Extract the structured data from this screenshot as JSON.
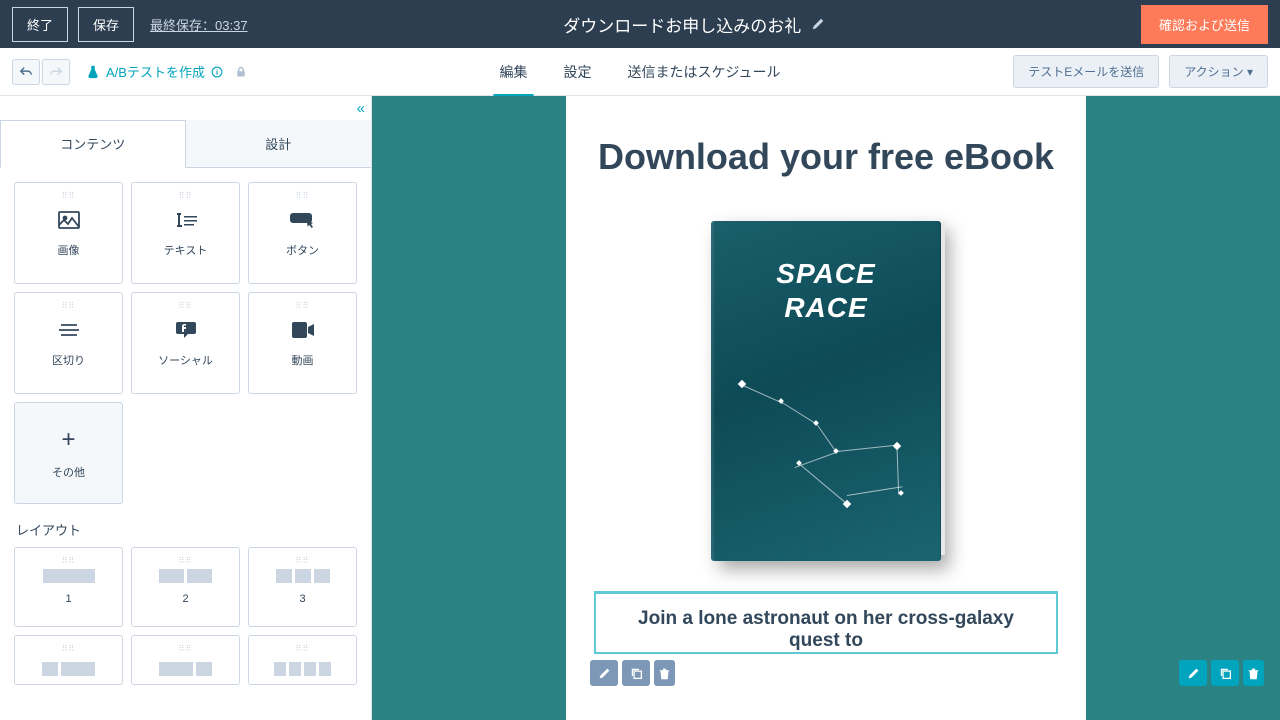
{
  "topbar": {
    "exit": "終了",
    "save": "保存",
    "lastSaved": "最終保存：03:37",
    "title": "ダウンロードお申し込みのお礼",
    "primary": "確認および送信"
  },
  "subbar": {
    "abTest": "A/Bテストを作成",
    "tabs": {
      "edit": "編集",
      "settings": "設定",
      "send": "送信またはスケジュール"
    },
    "testEmail": "テストEメールを送信",
    "actions": "アクション ▾"
  },
  "sidebar": {
    "collapse": "«",
    "tabs": {
      "content": "コンテンツ",
      "design": "設計"
    },
    "blocks": {
      "image": "画像",
      "text": "テキスト",
      "button": "ボタン",
      "divider": "区切り",
      "social": "ソーシャル",
      "video": "動画",
      "more": "その他"
    },
    "layoutHeader": "レイアウト",
    "layouts": {
      "one": "1",
      "two": "2",
      "three": "3"
    }
  },
  "email": {
    "headline": "Download your free eBook",
    "bookTitleLine1": "SPACE",
    "bookTitleLine2": "RACE",
    "subhead": "Join a lone astronaut on her cross-galaxy quest to"
  }
}
